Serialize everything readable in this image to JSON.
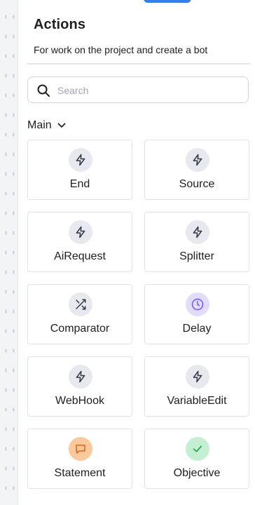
{
  "panel": {
    "title": "Actions",
    "subtitle": "For work on the project and create a bot"
  },
  "search": {
    "placeholder": "Search",
    "value": ""
  },
  "section": {
    "label": "Main",
    "expanded": true
  },
  "actions": [
    {
      "label": "End",
      "icon": "lightning-icon",
      "icon_bg": "#e8e9ee",
      "icon_color": "#333a44"
    },
    {
      "label": "Source",
      "icon": "lightning-icon",
      "icon_bg": "#e8e9ee",
      "icon_color": "#333a44"
    },
    {
      "label": "AiRequest",
      "icon": "lightning-icon",
      "icon_bg": "#e8e9ee",
      "icon_color": "#333a44"
    },
    {
      "label": "Splitter",
      "icon": "lightning-icon",
      "icon_bg": "#e8e9ee",
      "icon_color": "#333a44"
    },
    {
      "label": "Comparator",
      "icon": "shuffle-icon",
      "icon_bg": "#e8e9ee",
      "icon_color": "#333a44"
    },
    {
      "label": "Delay",
      "icon": "clock-icon",
      "icon_bg": "#e4dcfd",
      "icon_color": "#7b61ff"
    },
    {
      "label": "WebHook",
      "icon": "lightning-icon",
      "icon_bg": "#e8e9ee",
      "icon_color": "#333a44"
    },
    {
      "label": "VariableEdit",
      "icon": "lightning-icon",
      "icon_bg": "#e8e9ee",
      "icon_color": "#333a44"
    },
    {
      "label": "Statement",
      "icon": "message-icon",
      "icon_bg": "#fbc99c",
      "icon_color": "#e0631d"
    },
    {
      "label": "Objective",
      "icon": "check-icon",
      "icon_bg": "#c5efd2",
      "icon_color": "#27a95a"
    }
  ]
}
